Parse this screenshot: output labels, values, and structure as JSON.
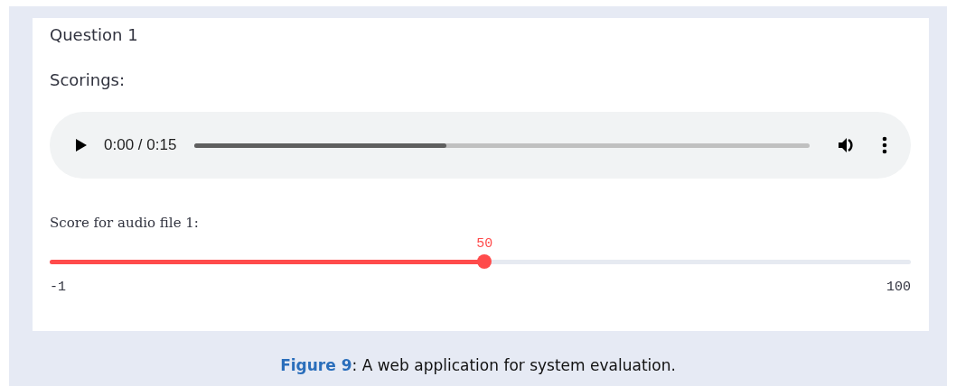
{
  "question": {
    "title": "Question 1"
  },
  "section_label": "Scorings:",
  "audio": {
    "time": "0:00 / 0:15",
    "level": 0.41
  },
  "slider": {
    "label": "Score for audio file 1:",
    "value": "50",
    "min": "-1",
    "max": "100",
    "level": 0.505
  },
  "caption": "**Figure 9**: A web application for system evaluation."
}
